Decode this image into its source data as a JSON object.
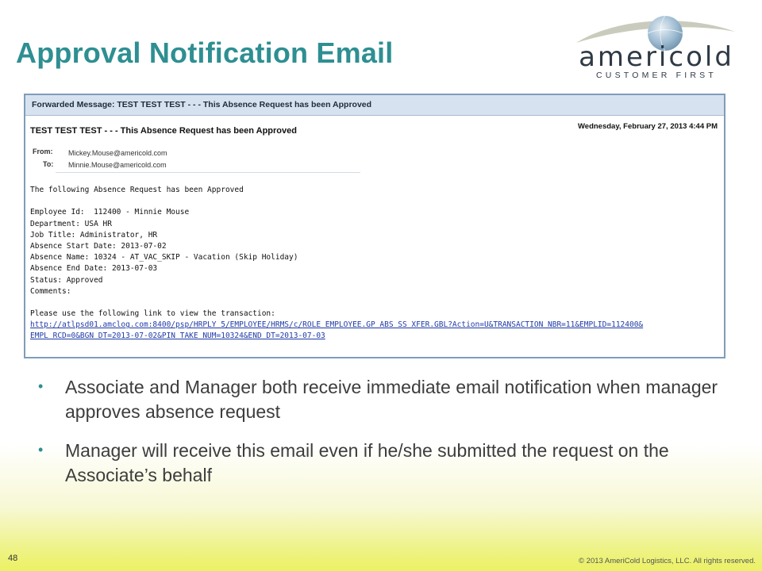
{
  "slide": {
    "title": "Approval Notification Email",
    "page_number": "48",
    "copyright": "© 2013 AmeriCold Logistics, LLC. All rights reserved."
  },
  "logo": {
    "word": "americold",
    "tagline": "CUSTOMER FIRST",
    "globe_color": "#7fa9c8",
    "swoosh_color": "#c2c7b5"
  },
  "email": {
    "forward_bar": "Forwarded Message: TEST TEST TEST - - - This Absence Request has been Approved",
    "subject": "TEST TEST TEST - - - This Absence Request has been Approved",
    "date": "Wednesday, February 27, 2013 4:44 PM",
    "from_label": "From:",
    "to_label": "To:",
    "from_address": "Mickey.Mouse@americold.com",
    "to_address": "Minnie.Mouse@americold.com",
    "body": {
      "intro": "The following Absence Request has been Approved",
      "employee_id": "Employee Id:  112400 - Minnie Mouse",
      "department": "Department: USA HR",
      "job_title": "Job Title: Administrator, HR",
      "start_date": "Absence Start Date: 2013-07-02",
      "absence_name": "Absence Name: 10324 - AT_VAC_SKIP - Vacation (Skip Holiday)",
      "end_date": "Absence End Date: 2013-07-03",
      "status": "Status: Approved",
      "comments": "Comments:",
      "link_intro": "Please use the following link to view the transaction:",
      "link_line1": "http://atlpsd01.amclog.com:8400/psp/HRPLY 5/EMPLOYEE/HRMS/c/ROLE EMPLOYEE.GP ABS SS XFER.GBL?Action=U&TRANSACTION NBR=11&EMPLID=112400&",
      "link_line2": "EMPL RCD=0&BGN DT=2013-07-02&PIN TAKE NUM=10324&END DT=2013-07-03"
    }
  },
  "bullets": [
    "Associate and Manager both receive immediate email notification when manager approves absence request",
    "Manager will receive this email even if he/she submitted the request on the Associate’s behalf"
  ],
  "colors": {
    "title": "#2e8f92",
    "link": "#1f3aa6",
    "email_border": "#7f9db9",
    "email_topbar": "#d7e2f0"
  }
}
